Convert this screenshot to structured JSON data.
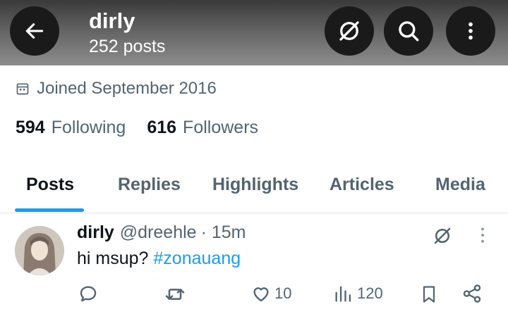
{
  "header": {
    "name": "dirly",
    "post_count": "252 posts",
    "icons": [
      "back-arrow-icon",
      "grok-icon",
      "search-icon",
      "more-vertical-icon"
    ]
  },
  "profile": {
    "joined": "Joined September 2016",
    "following_count": "594",
    "following_label": "Following",
    "followers_count": "616",
    "followers_label": "Followers"
  },
  "tabs": [
    {
      "label": "Posts",
      "active": true
    },
    {
      "label": "Replies"
    },
    {
      "label": "Highlights"
    },
    {
      "label": "Articles"
    },
    {
      "label": "Media"
    }
  ],
  "tweet": {
    "name": "dirly",
    "handle": "@dreehle",
    "time": "· 15m",
    "text": "hi msup? ",
    "hashtag": "#zonauang",
    "likes": "10",
    "views": "120"
  },
  "colors": {
    "accent": "#1d9bf0",
    "secondary_text": "#536471",
    "primary_text": "#0f1419"
  }
}
